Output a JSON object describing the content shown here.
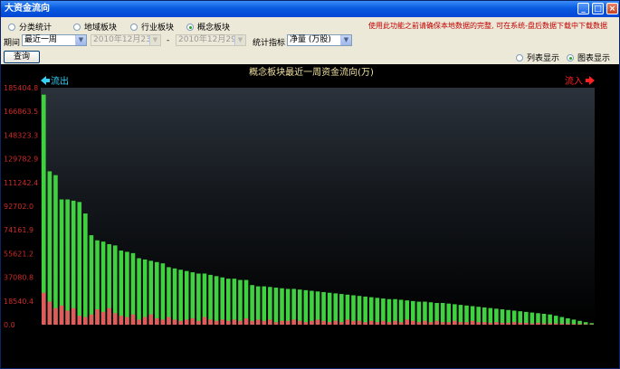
{
  "window": {
    "title": "大资金流向",
    "min": "_",
    "max": "□",
    "close": "×"
  },
  "tabs": [
    {
      "label": "分类统计",
      "selected": false
    },
    {
      "label": "地域板块",
      "selected": false
    },
    {
      "label": "行业板块",
      "selected": false
    },
    {
      "label": "概念板块",
      "selected": true
    }
  ],
  "notice": "使用此功能之前请确保本地数据的完整, 可在系统-盘后数据下载中下载数据",
  "filter": {
    "period_label": "期间",
    "period_value": "最近一周",
    "date_from": "2010年12月23日",
    "date_sep": "-",
    "date_to": "2010年12月29日",
    "metric_label": "统计指标",
    "metric_value": "净量 (万股)",
    "query_button": "查询"
  },
  "view": [
    {
      "label": "列表显示",
      "selected": false
    },
    {
      "label": "图表显示",
      "selected": true
    }
  ],
  "colors": {
    "outflow": "#e05c5c",
    "inflow": "#3fd13f",
    "axis_text": "#cc2a2a",
    "title": "#f0e0a0",
    "out_arrow": "#35d0f5",
    "in_arrow": "#ff2020"
  },
  "chart_data": {
    "type": "bar",
    "title": "概念板块最近一周资金流向(万)",
    "outflow_label": "流出",
    "inflow_label": "流入",
    "ylim": [
      0,
      185404.8
    ],
    "yticks": [
      "185404.8",
      "166863.5",
      "148323.3",
      "129782.9",
      "111242.4",
      "92702.0",
      "74161.9",
      "55621.2",
      "37080.8",
      "18540.4",
      "0.0"
    ],
    "series": [
      {
        "name": "流入",
        "values": [
          180000,
          120000,
          117000,
          98000,
          98000,
          97000,
          96000,
          87000,
          70000,
          66000,
          65000,
          63000,
          62000,
          58000,
          57000,
          56000,
          52000,
          51000,
          50000,
          49000,
          48000,
          45000,
          44000,
          43000,
          42000,
          41000,
          40000,
          40000,
          39000,
          38000,
          37000,
          36000,
          36000,
          35000,
          35000,
          31000,
          30000,
          30000,
          29500,
          29000,
          28500,
          28000,
          28000,
          27500,
          27000,
          26500,
          26000,
          25500,
          25000,
          24500,
          24000,
          23500,
          23000,
          22500,
          22000,
          21500,
          21000,
          20500,
          20000,
          20000,
          19500,
          19000,
          18500,
          18000,
          18000,
          17500,
          17000,
          17000,
          16500,
          16000,
          15500,
          15000,
          14500,
          14000,
          13500,
          13000,
          12500,
          12000,
          11500,
          11000,
          10500,
          10000,
          9500,
          9000,
          8500,
          8000,
          7000,
          6000,
          5000,
          4000,
          3000,
          2000,
          1200
        ]
      },
      {
        "name": "流出",
        "values": [
          25000,
          18000,
          13000,
          15000,
          11000,
          13000,
          7000,
          6000,
          8000,
          12000,
          10000,
          13000,
          9000,
          7000,
          6000,
          8000,
          4000,
          6000,
          8000,
          5000,
          4000,
          6000,
          4000,
          3000,
          4000,
          5000,
          3000,
          6000,
          4000,
          3000,
          4000,
          3000,
          4000,
          3000,
          5000,
          3000,
          4000,
          3000,
          4000,
          2000,
          3000,
          3000,
          4000,
          3000,
          2000,
          3000,
          4000,
          3000,
          2000,
          3000,
          2000,
          4000,
          3000,
          3000,
          2000,
          3000,
          2000,
          3000,
          2000,
          3000,
          2000,
          4000,
          3000,
          2000,
          3000,
          2000,
          3000,
          2000,
          2000,
          3000,
          2000,
          2000,
          3000,
          2000,
          2000,
          1500,
          2000,
          1500,
          1500,
          2000,
          1500,
          1500,
          1000,
          1500,
          1000,
          1000,
          1000,
          800,
          800,
          600,
          500,
          400,
          300
        ]
      }
    ]
  }
}
